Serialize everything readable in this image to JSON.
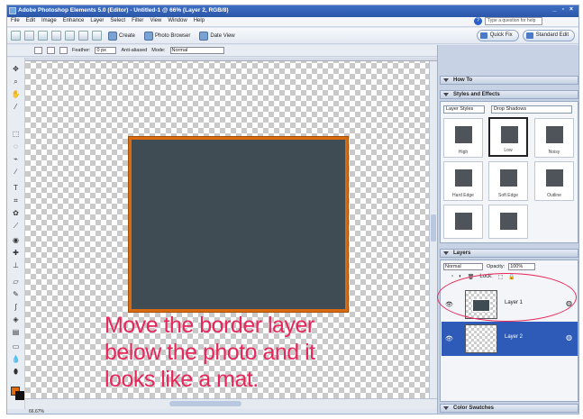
{
  "window": {
    "title": "Adobe Photoshop Elements 5.0 (Editor) - Untitled-1 @ 66% (Layer 2, RGB/8)",
    "controls": "_ ▫ ×"
  },
  "menu": {
    "items": [
      "File",
      "Edit",
      "Image",
      "Enhance",
      "Layer",
      "Select",
      "Filter",
      "View",
      "Window",
      "Help"
    ],
    "help_placeholder": "Type a question for help"
  },
  "toolbar": {
    "create_label": "Create",
    "photo_browser_label": "Photo Browser",
    "date_view_label": "Date View",
    "quick_fix_label": "Quick Fix",
    "standard_edit_label": "Standard Edit"
  },
  "options": {
    "feather_label": "Feather:",
    "feather_value": "0 px",
    "anti_alias_label": "Anti-aliased",
    "mode_label": "Mode:",
    "mode_value": "Normal"
  },
  "panels": {
    "how_to_title": "How To",
    "artwork_title": "Styles and Effects",
    "category_select": "Layer Styles",
    "subcategory_select": "Drop Shadows",
    "styles": [
      {
        "label": "High"
      },
      {
        "label": "Low"
      },
      {
        "label": "Noisy"
      },
      {
        "label": "Hard Edge"
      },
      {
        "label": "Soft Edge"
      },
      {
        "label": "Outline"
      },
      {
        "label": ""
      },
      {
        "label": ""
      }
    ],
    "layers_title": "Layers",
    "blend_mode": "Normal",
    "opacity_label": "Opacity:",
    "opacity_value": "100%",
    "lock_label": "Lock:",
    "layers": [
      {
        "name": "Layer 1"
      },
      {
        "name": "Layer 2"
      }
    ],
    "color_swatches_title": "Color Swatches"
  },
  "annotation": {
    "line1": "Move the border layer",
    "line2": "below the photo and it",
    "line3": "looks like a mat."
  },
  "status": {
    "zoom": "66.67%"
  },
  "colors": {
    "annotation": "#e8265a",
    "border_orange": "#d86a10",
    "photo_fill": "#3f4c53",
    "selected_layer": "#2f5bb8"
  }
}
